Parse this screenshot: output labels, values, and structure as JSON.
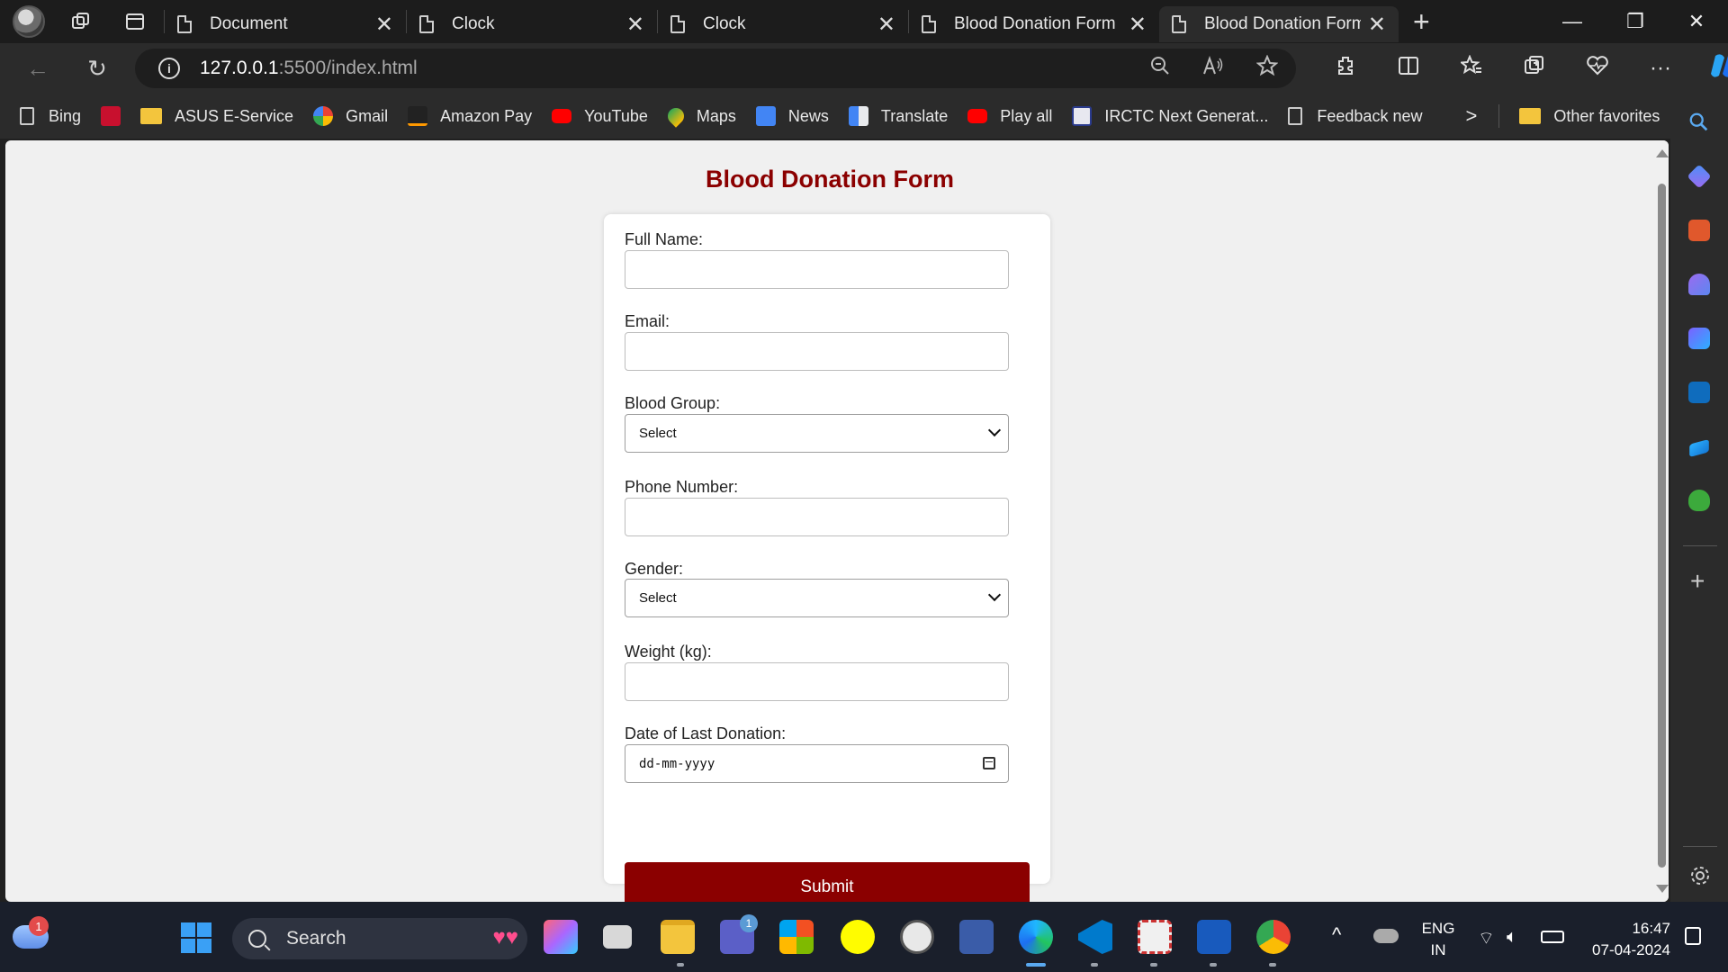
{
  "browser": {
    "tabs": [
      {
        "label": "Document"
      },
      {
        "label": "Clock"
      },
      {
        "label": "Clock"
      },
      {
        "label": "Blood Donation Form"
      },
      {
        "label": "Blood Donation Form",
        "active": true
      }
    ],
    "tab_close": "✕",
    "new_tab": "+",
    "window_controls": {
      "minimize": "—",
      "restore": "❐",
      "close": "✕"
    },
    "address": {
      "host": "127.0.0.1",
      "path": ":5500/index.html",
      "info": "i"
    },
    "nav": {
      "back": "←",
      "reload": "↻"
    }
  },
  "favorites": [
    {
      "label": "Bing",
      "icon": "page-icon"
    },
    {
      "label": "",
      "icon": "pdf-icon"
    },
    {
      "label": "ASUS E-Service",
      "icon": "folder-icon"
    },
    {
      "label": "Gmail",
      "icon": "google-icon"
    },
    {
      "label": "Amazon Pay",
      "icon": "amazon-icon"
    },
    {
      "label": "YouTube",
      "icon": "youtube-icon"
    },
    {
      "label": "Maps",
      "icon": "maps-icon"
    },
    {
      "label": "News",
      "icon": "news-icon"
    },
    {
      "label": "Translate",
      "icon": "translate-icon"
    },
    {
      "label": "Play all",
      "icon": "youtube-icon"
    },
    {
      "label": "IRCTC Next Generat...",
      "icon": "irctc-icon"
    },
    {
      "label": "Feedback new",
      "icon": "page-icon"
    }
  ],
  "favorites_more": ">",
  "other_favorites": "Other favorites",
  "form": {
    "title": "Blood Donation Form",
    "full_name_label": "Full Name:",
    "email_label": "Email:",
    "blood_group_label": "Blood Group:",
    "blood_group_value": "Select",
    "phone_label": "Phone Number:",
    "gender_label": "Gender:",
    "gender_value": "Select",
    "weight_label": "Weight (kg):",
    "last_donation_label": "Date of Last Donation:",
    "last_donation_placeholder": "dd-mm-yyyy",
    "submit_label": "Submit"
  },
  "taskbar": {
    "search_label": "Search",
    "weather_badge": "1",
    "teams_badge": "1",
    "language_top": "ENG",
    "language_bottom": "IN",
    "time": "16:47",
    "date": "07-04-2024",
    "chevron": "^"
  },
  "colors": {
    "accent": "#8b0000",
    "page_bg": "#f0f0f0",
    "chrome_bg": "#2b2b2b"
  }
}
